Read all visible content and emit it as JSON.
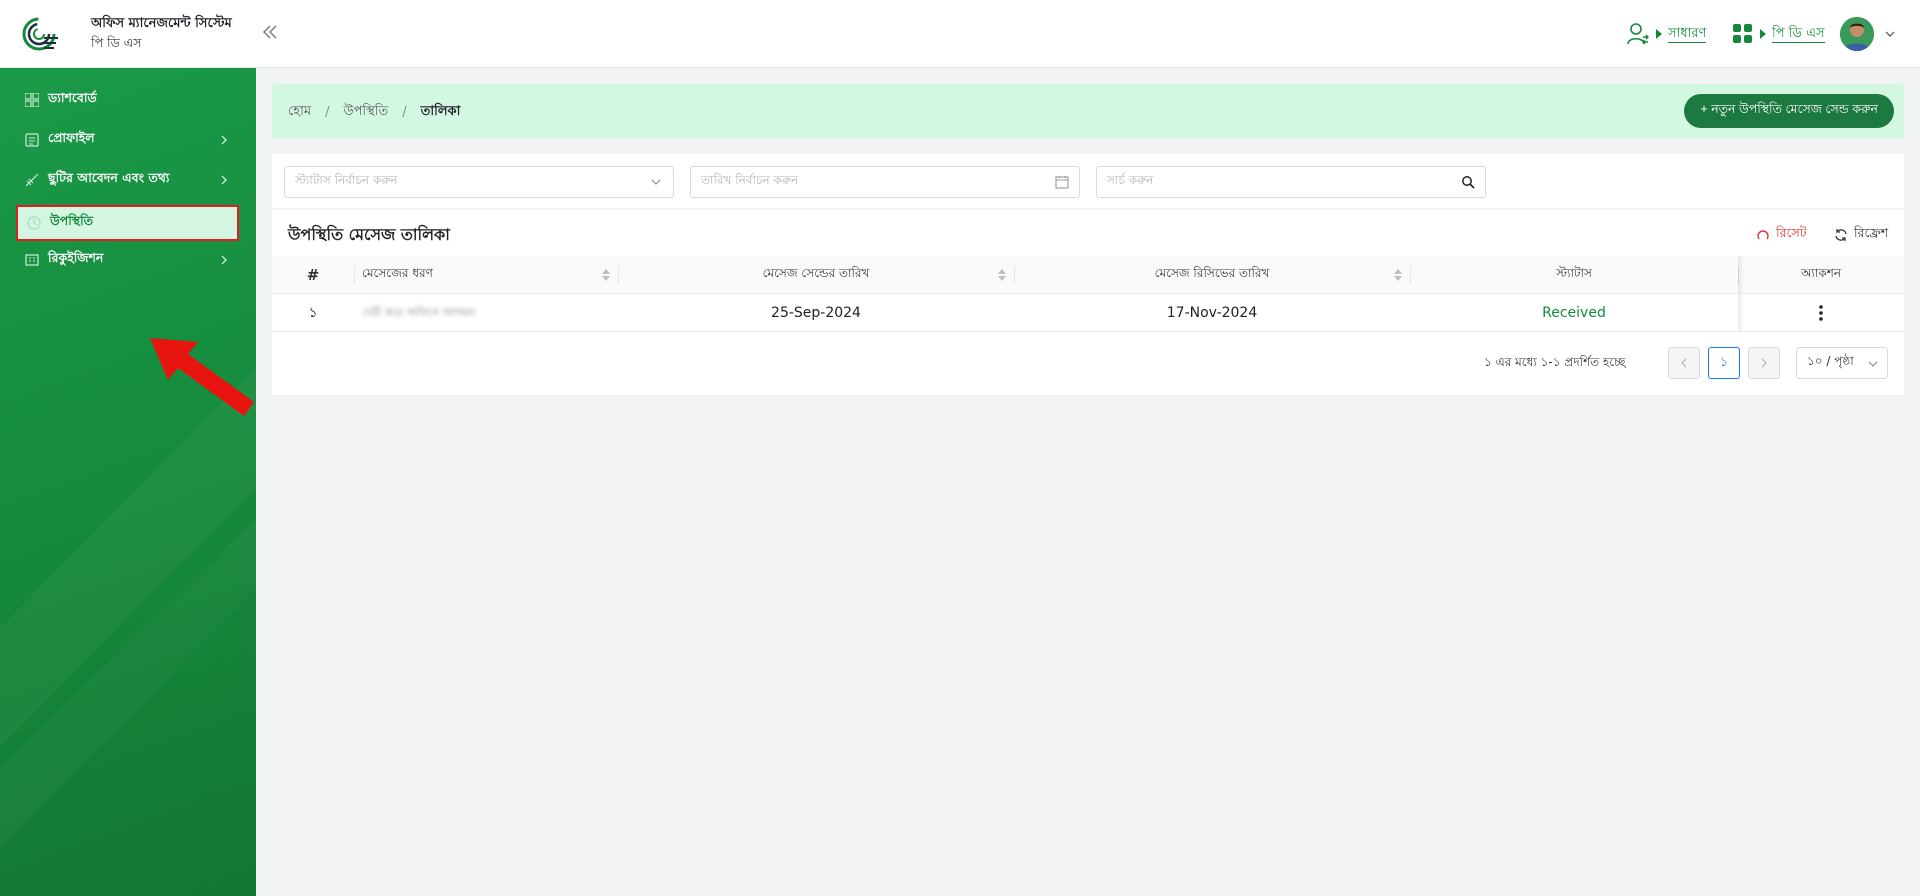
{
  "header": {
    "app_title": "অফিস ম্যানেজমেন্ট সিস্টেম",
    "app_subtitle": "পি ডি এস",
    "role_label": "সাধারণ",
    "module_label": "পি ডি এস"
  },
  "sidebar": {
    "items": [
      {
        "label": "ড্যাশবোর্ড",
        "icon": "dashboard-grid-icon",
        "has_children": false
      },
      {
        "label": "প্রোফাইল",
        "icon": "profile-card-icon",
        "has_children": true
      },
      {
        "label": "ছুটির আবেদন এবং তথ্য",
        "icon": "leave-plane-icon",
        "has_children": true
      },
      {
        "label": "উপস্থিতি",
        "icon": "clock-icon",
        "has_children": false,
        "active": true
      },
      {
        "label": "রিকুইজিশন",
        "icon": "requisition-icon",
        "has_children": true
      }
    ]
  },
  "breadcrumb": {
    "home": "হোম",
    "section": "উপস্থিতি",
    "current": "তালিকা"
  },
  "actions": {
    "new_button": "+ নতুন উপস্থিতি মেসেজ সেন্ড করুন"
  },
  "filters": {
    "status_placeholder": "স্ট্যাটাস নির্বাচন করুন",
    "date_placeholder": "তারিখ নির্বাচন করুন",
    "search_placeholder": "সার্চ করুন"
  },
  "table": {
    "title": "উপস্থিতি মেসেজ তালিকা",
    "reset_label": "রিসেট",
    "refresh_label": "রিফ্রেশ",
    "columns": {
      "index": "#",
      "message_type": "মেসেজের ধরণ",
      "send_date": "মেসেজ সেন্ডের তারিখ",
      "receive_date": "মেসেজ রিসিভের তারিখ",
      "status": "স্ট্যাটাস",
      "action": "অ্যাকশন"
    },
    "rows": [
      {
        "index": "১",
        "message_type": "দেরী করে অফিসে আগমন",
        "send_date": "25-Sep-2024",
        "receive_date": "17-Nov-2024",
        "status": "Received"
      }
    ]
  },
  "pagination": {
    "info": "১ এর মধ্যে ১-১ প্রদর্শিত হচ্ছে",
    "current_page": "১",
    "page_size": "১০ / পৃষ্ঠা"
  },
  "colors": {
    "brand_green": "#15893b",
    "active_bg": "#d4f5e1",
    "highlight_red": "#e02020",
    "breadcrumb_bg": "#d4f7e2"
  }
}
